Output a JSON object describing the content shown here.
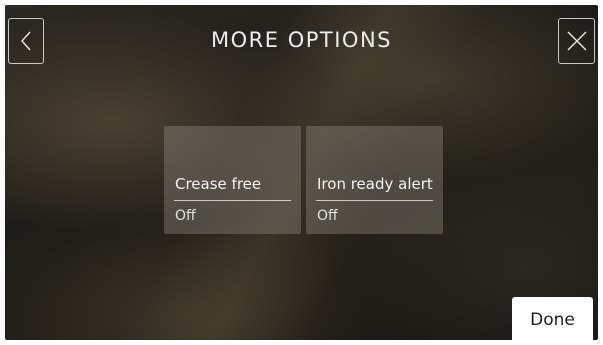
{
  "header": {
    "title": "MORE OPTIONS",
    "back_icon": "chevron-left-icon",
    "close_icon": "close-icon"
  },
  "options": [
    {
      "label": "Crease free",
      "value": "Off"
    },
    {
      "label": "Iron ready alert",
      "value": "Off"
    }
  ],
  "footer": {
    "done_label": "Done"
  },
  "colors": {
    "background": "#24211c",
    "card": "#6b675f",
    "done_bg": "#ffffff",
    "text": "#f2f2f2"
  }
}
